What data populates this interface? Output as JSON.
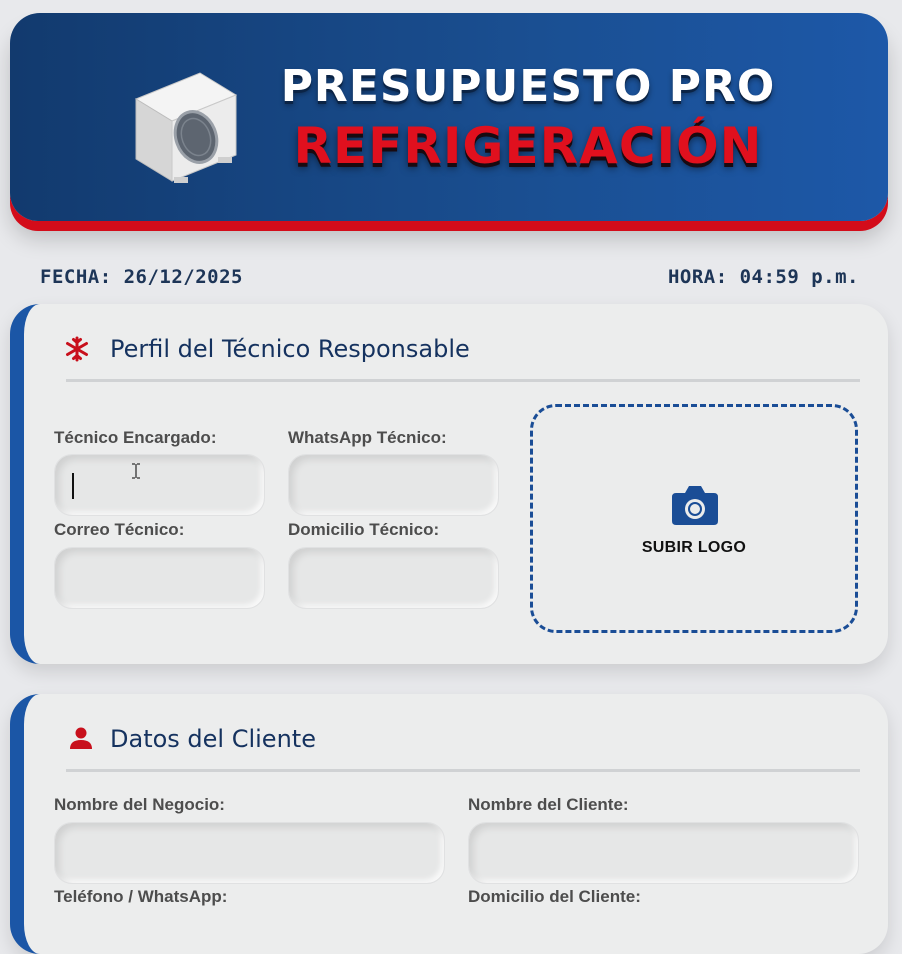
{
  "header": {
    "title_line1": "PRESUPUESTO PRO",
    "title_line2": "REFRIGERACIÓN"
  },
  "datetime": {
    "date": "FECHA: 26/12/2025",
    "time": "HORA: 04:59 p.m."
  },
  "technician": {
    "title": "Perfil del Técnico Responsable",
    "icon": "snowflake-icon",
    "fields": {
      "name_label": "Técnico Encargado:",
      "whatsapp_label": "WhatsApp Técnico:",
      "email_label": "Correo Técnico:",
      "address_label": "Domicilio Técnico:"
    },
    "upload_label": "SUBIR LOGO"
  },
  "client": {
    "title": "Datos del Cliente",
    "icon": "user-icon",
    "fields": {
      "business_label": "Nombre del Negocio:",
      "client_label": "Nombre del Cliente:",
      "phone_label": "Teléfono / WhatsApp:",
      "address_label": "Domicilio del Cliente:"
    }
  },
  "colors": {
    "brand_blue": "#1b56a6",
    "accent_red": "#d30c1a",
    "title_navy": "#15325f"
  }
}
